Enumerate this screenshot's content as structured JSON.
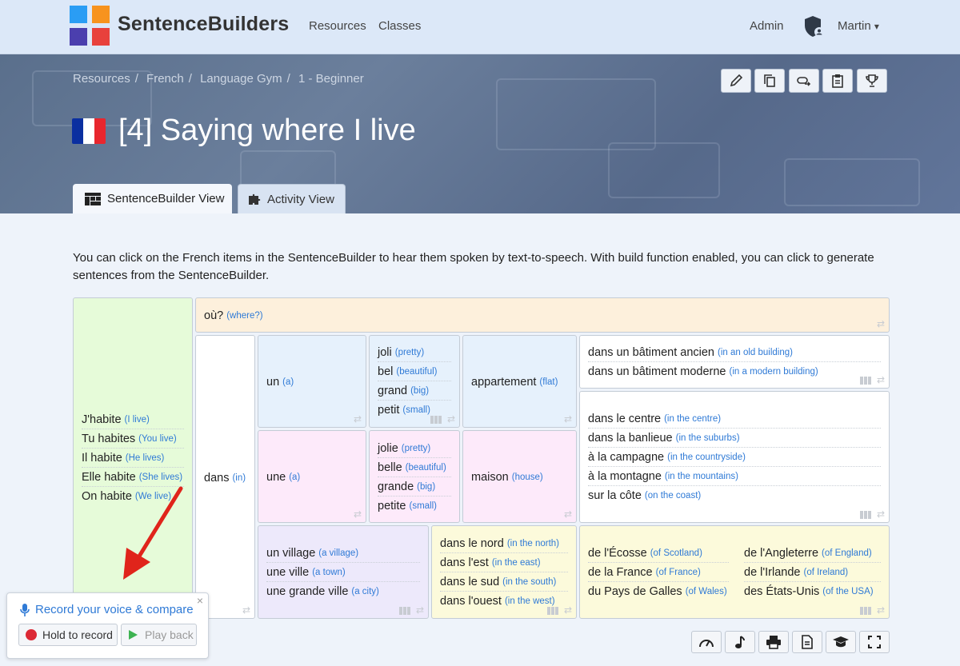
{
  "nav": {
    "brand": "SentenceBuilders",
    "links": [
      "Resources",
      "Classes"
    ],
    "admin": "Admin",
    "user": "Martin",
    "user_caret": "▾"
  },
  "breadcrumb": {
    "items": [
      "Resources",
      "French",
      "Language Gym",
      "1 - Beginner"
    ],
    "sep": "/"
  },
  "page": {
    "title": "[4] Saying where I live"
  },
  "toolbar": {
    "icons": [
      "pencil-icon",
      "copy-icon",
      "link-icon",
      "clipboard-icon",
      "trophy-icon"
    ]
  },
  "tabs": [
    {
      "label": "SentenceBuilder View"
    },
    {
      "label": "Activity View"
    }
  ],
  "intro": "You can click on the French items in the SentenceBuilder to hear them spoken by text-to-speech. With build function enabled, you can click to generate sentences from the SentenceBuilder.",
  "builder": {
    "subjects": [
      {
        "fr": "J'habite",
        "en": "(I live)"
      },
      {
        "fr": "Tu habites",
        "en": "(You live)"
      },
      {
        "fr": "Il habite",
        "en": "(He lives)"
      },
      {
        "fr": "Elle habite",
        "en": "(She lives)"
      },
      {
        "fr": "On habite",
        "en": "(We live)"
      }
    ],
    "where": {
      "fr": "où?",
      "en": "(where?)"
    },
    "dans": {
      "fr": "dans",
      "en": "(in)"
    },
    "un": {
      "fr": "un",
      "en": "(a)"
    },
    "une": {
      "fr": "une",
      "en": "(a)"
    },
    "adj_m": [
      {
        "fr": "joli",
        "en": "(pretty)"
      },
      {
        "fr": "bel",
        "en": "(beautiful)"
      },
      {
        "fr": "grand",
        "en": "(big)"
      },
      {
        "fr": "petit",
        "en": "(small)"
      }
    ],
    "adj_f": [
      {
        "fr": "jolie",
        "en": "(pretty)"
      },
      {
        "fr": "belle",
        "en": "(beautiful)"
      },
      {
        "fr": "grande",
        "en": "(big)"
      },
      {
        "fr": "petite",
        "en": "(small)"
      }
    ],
    "appartement": {
      "fr": "appartement",
      "en": "(flat)"
    },
    "maison": {
      "fr": "maison",
      "en": "(house)"
    },
    "buildings": [
      {
        "fr": "dans un bâtiment ancien",
        "en": "(in an old building)"
      },
      {
        "fr": "dans un bâtiment moderne",
        "en": "(in a modern building)"
      }
    ],
    "locations": [
      {
        "fr": "dans le centre",
        "en": "(in the centre)"
      },
      {
        "fr": "dans la banlieue",
        "en": "(in the suburbs)"
      },
      {
        "fr": "à la campagne",
        "en": "(in the countryside)"
      },
      {
        "fr": "à la montagne",
        "en": "(in the mountains)"
      },
      {
        "fr": "sur la côte",
        "en": "(on the coast)"
      }
    ],
    "places": [
      {
        "fr": "un village",
        "en": "(a village)"
      },
      {
        "fr": "une ville",
        "en": "(a town)"
      },
      {
        "fr": "une grande ville",
        "en": "(a city)"
      }
    ],
    "directions": [
      {
        "fr": "dans le nord",
        "en": "(in the north)"
      },
      {
        "fr": "dans l'est",
        "en": "(in the east)"
      },
      {
        "fr": "dans le sud",
        "en": "(in the south)"
      },
      {
        "fr": "dans l'ouest",
        "en": "(in the west)"
      }
    ],
    "countries_left": [
      {
        "fr": "de l'Écosse",
        "en": "(of Scotland)"
      },
      {
        "fr": "de la France",
        "en": "(of France)"
      },
      {
        "fr": "du Pays de Galles",
        "en": "(of Wales)"
      }
    ],
    "countries_right": [
      {
        "fr": "de l'Angleterre",
        "en": "(of England)"
      },
      {
        "fr": "de l'Irlande",
        "en": "(of Ireland)"
      },
      {
        "fr": "des États-Unis",
        "en": "(of the USA)"
      }
    ]
  },
  "recorder": {
    "title": "Record your voice & compare",
    "hold": "Hold to record",
    "play": "Play back",
    "close": "×"
  },
  "bottom_toolbar": {
    "icons": [
      "speedometer-icon",
      "music-note-icon",
      "printer-icon",
      "document-icon",
      "graduation-cap-icon",
      "fullscreen-icon"
    ]
  },
  "colors": {
    "accent": "#2f7ad6",
    "subjects_bg": "#e6fbd9",
    "where_bg": "#fdf0dc",
    "masc_bg": "#e6f1fc",
    "fem_bg": "#fdeafa",
    "place_bg": "#ede9fb",
    "yellow_bg": "#fcfadb",
    "arrow": "#e0241b"
  }
}
